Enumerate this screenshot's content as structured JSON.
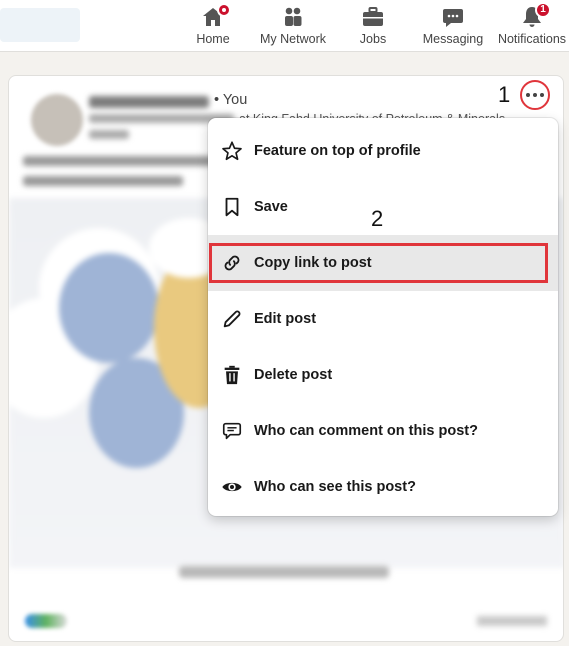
{
  "topnav": {
    "items": [
      {
        "label": "Home",
        "icon": "home-icon"
      },
      {
        "label": "My Network",
        "icon": "network-icon"
      },
      {
        "label": "Jobs",
        "icon": "jobs-icon"
      },
      {
        "label": "Messaging",
        "icon": "messaging-icon"
      },
      {
        "label": "Notifications",
        "icon": "bell-icon",
        "badge": "1"
      }
    ]
  },
  "post": {
    "author_suffix": "• You",
    "headline": "at King Fahd University of Petroleum & Minerals -"
  },
  "annotations": {
    "step1": "1",
    "step2": "2"
  },
  "menu": {
    "items": [
      {
        "label": "Feature on top of profile",
        "icon": "star-icon"
      },
      {
        "label": "Save",
        "icon": "bookmark-icon"
      },
      {
        "label": "Copy link to post",
        "icon": "link-icon"
      },
      {
        "label": "Edit post",
        "icon": "pencil-icon"
      },
      {
        "label": "Delete post",
        "icon": "trash-icon"
      },
      {
        "label": "Who can comment on this post?",
        "icon": "comment-icon"
      },
      {
        "label": "Who can see this post?",
        "icon": "eye-icon"
      }
    ]
  },
  "colors": {
    "highlight": "#e0353b",
    "badge": "#cb112d"
  }
}
